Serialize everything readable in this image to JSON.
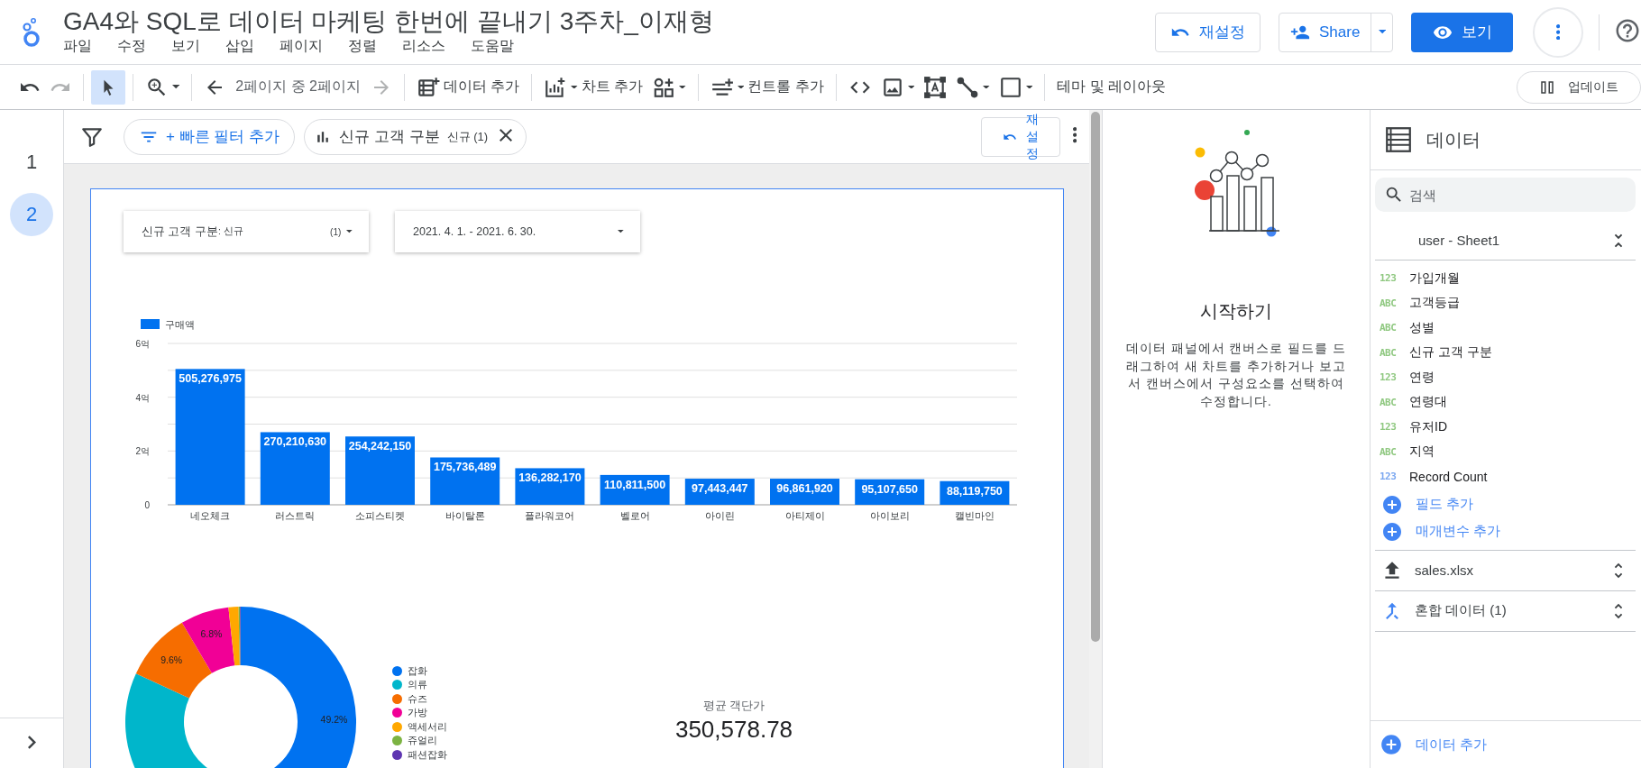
{
  "app": {
    "title": "GA4와 SQL로 데이터 마케팅 한번에 끝내기 3주차_이재형",
    "menus": [
      "파일",
      "수정",
      "보기",
      "삽입",
      "페이지",
      "정렬",
      "리소스",
      "도움말"
    ]
  },
  "header_actions": {
    "reset": "재설정",
    "share": "Share",
    "view": "보기"
  },
  "toolbar": {
    "redo_disabled": true,
    "pointer_selected": true,
    "page_text": "2페이지 중 2페이지",
    "next_disabled": true,
    "add_data": "데이터 추가",
    "add_chart": "차트 추가",
    "add_control": "컨트롤 추가",
    "theme": "테마 및 레이아웃",
    "update": "업데이트"
  },
  "pages": [
    {
      "label": "1",
      "selected": false
    },
    {
      "label": "2",
      "selected": true
    }
  ],
  "filter_bar": {
    "quick_filter": "+ 빠른 필터 추가",
    "chips": [
      {
        "label": "신규 고객 구분",
        "value": "신규 (1)"
      }
    ],
    "reset": "재설정"
  },
  "report": {
    "controls": [
      {
        "kind": "dropdown",
        "label": "신규 고객 구분",
        "value": ": 신규",
        "count": "(1)"
      },
      {
        "kind": "date",
        "value": "2021. 4. 1. - 2021. 6. 30."
      }
    ],
    "bar_chart": {
      "chart_data": {
        "type": "bar",
        "categories": [
          "네오체크",
          "러스트릭",
          "소피스티켓",
          "바이탈론",
          "플라워코어",
          "벨로어",
          "아이린",
          "아티제이",
          "아이보리",
          "캘빈마인"
        ],
        "series": [
          {
            "name": "구매액",
            "color": "#0072f0",
            "values": [
              5.05,
              2.7,
              2.54,
              1.76,
              1.36,
              1.11,
              0.97,
              0.97,
              0.95,
              0.88
            ]
          }
        ],
        "ylim": [
          0,
          6
        ],
        "yticks": [
          {
            "value": 0,
            "label": "0"
          },
          {
            "value": 2,
            "label": "2억"
          },
          {
            "value": 4,
            "label": "4억"
          },
          {
            "value": 6,
            "label": "6억"
          }
        ],
        "value_labels": [
          "505,276,975",
          "270,210,630",
          "254,242,150",
          "175,736,489",
          "136,282,170",
          "110,811,500",
          "97,443,447",
          "96,861,920",
          "95,107,650",
          "88,119,750"
        ]
      }
    },
    "donut_chart": {
      "chart_data": {
        "type": "donut",
        "categories": [
          "잡화",
          "의류",
          "슈즈",
          "가방",
          "액세서리",
          "쥬얼리",
          "패션잡화"
        ],
        "values": [
          49.2,
          32.7,
          9.6,
          6.8,
          1.4,
          0.2,
          0.1
        ],
        "colors": [
          "#0072f0",
          "#00b6cb",
          "#f66d00",
          "#f10096",
          "#ffa800",
          "#7cb342",
          "#5e35b1"
        ],
        "value_labels": [
          "49.2%",
          null,
          "9.6%",
          "6.8%",
          null,
          null,
          null
        ],
        "legend": "right"
      }
    },
    "scorecard": {
      "label": "평균 객단가",
      "value": "350,578.78"
    }
  },
  "properties": {
    "title": "시작하기",
    "text": "데이터 패널에서 캔버스로 필드를 드래그하여 새 차트를 추가하거나 보고서 캔버스에서 구성요소를 선택하여 수정합니다."
  },
  "data_panel": {
    "title": "데이터",
    "search": {
      "placeholder": "검색"
    },
    "sources": [
      {
        "kind": "sheet",
        "name": "user - Sheet1",
        "expanded": true,
        "fields": [
          {
            "type": "123",
            "name": "가입개월",
            "color": "#8fc880"
          },
          {
            "type": "ABC",
            "name": "고객등급",
            "color": "#8fc880"
          },
          {
            "type": "ABC",
            "name": "성별",
            "color": "#8fc880"
          },
          {
            "type": "ABC",
            "name": "신규 고객 구분",
            "color": "#8fc880"
          },
          {
            "type": "123",
            "name": "연령",
            "color": "#8fc880"
          },
          {
            "type": "ABC",
            "name": "연령대",
            "color": "#8fc880"
          },
          {
            "type": "123",
            "name": "유저ID",
            "color": "#8fc880"
          },
          {
            "type": "ABC",
            "name": "지역",
            "color": "#8fc880"
          },
          {
            "type": "123",
            "name": "Record Count",
            "color": "#7aa7f0"
          }
        ],
        "actions": [
          "필드 추가",
          "매개변수 추가"
        ]
      },
      {
        "kind": "upload",
        "name": "sales.xlsx",
        "expanded": false
      },
      {
        "kind": "blend",
        "name": "혼합 데이터 (1)",
        "expanded": false
      }
    ],
    "add_data": "데이터 추가"
  }
}
